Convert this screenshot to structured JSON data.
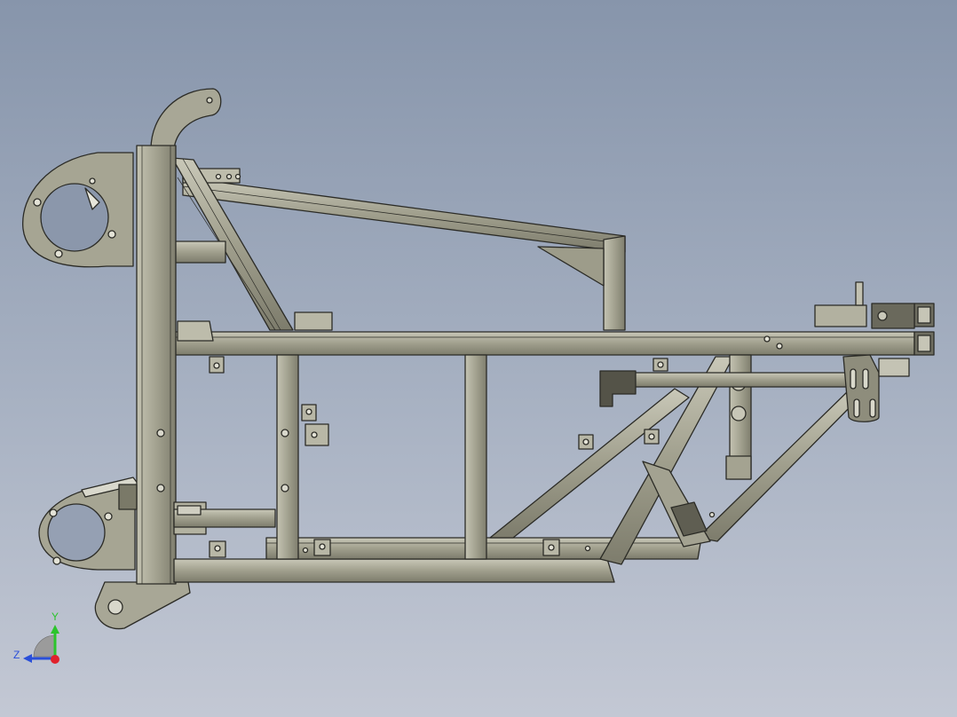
{
  "viewport": {
    "background_top": "#8795ab",
    "background_bottom": "#c3c8d4",
    "model_fill": "#9f9e8c",
    "model_edge": "#2b2b26"
  },
  "triad": {
    "y_label": "Y",
    "z_label": "Z",
    "y_color": "#2cc42c",
    "z_color": "#2a4fd9",
    "x_color": "#e0212b"
  }
}
